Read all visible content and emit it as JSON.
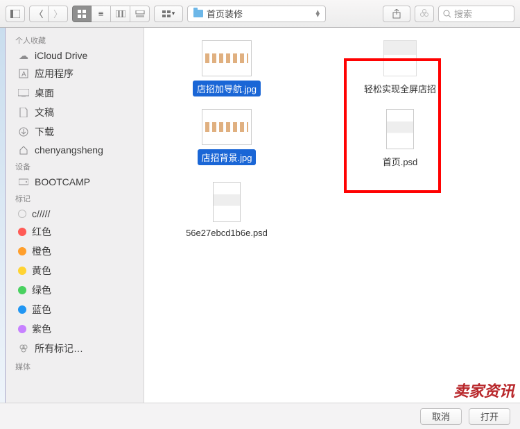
{
  "toolbar": {
    "folder_name": "首页装修",
    "search_placeholder": "搜索"
  },
  "sidebar": {
    "sections": [
      {
        "header": "个人收藏",
        "items": [
          {
            "label": "iCloud Drive",
            "icon": "cloud"
          },
          {
            "label": "应用程序",
            "icon": "app"
          },
          {
            "label": "桌面",
            "icon": "desktop"
          },
          {
            "label": "文稿",
            "icon": "doc"
          },
          {
            "label": "下载",
            "icon": "download"
          },
          {
            "label": "chenyangsheng",
            "icon": "home"
          }
        ]
      },
      {
        "header": "设备",
        "items": [
          {
            "label": "BOOTCAMP",
            "icon": "disk"
          }
        ]
      },
      {
        "header": "标记",
        "items": [
          {
            "label": "c/////",
            "tag": "none"
          },
          {
            "label": "红色",
            "tag": "red"
          },
          {
            "label": "橙色",
            "tag": "org"
          },
          {
            "label": "黄色",
            "tag": "yel"
          },
          {
            "label": "绿色",
            "tag": "grn"
          },
          {
            "label": "蓝色",
            "tag": "blu"
          },
          {
            "label": "紫色",
            "tag": "pur"
          },
          {
            "label": "所有标记…",
            "tag": "all"
          }
        ]
      },
      {
        "header": "媒体",
        "items": []
      }
    ]
  },
  "files": [
    {
      "name": "店招加导航.jpg",
      "selected": true,
      "kind": "wide"
    },
    {
      "name": "轻松实现全屏店招",
      "selected": false,
      "kind": "doc"
    },
    {
      "name": "店招背景.jpg",
      "selected": true,
      "kind": "wide"
    },
    {
      "name": "首页.psd",
      "selected": false,
      "kind": "tall"
    },
    {
      "name": "56e27ebcd1b6e.psd",
      "selected": false,
      "kind": "tall"
    }
  ],
  "footer": {
    "cancel": "取消",
    "open": "打开"
  },
  "watermark": {
    "main": "卖家资讯"
  }
}
